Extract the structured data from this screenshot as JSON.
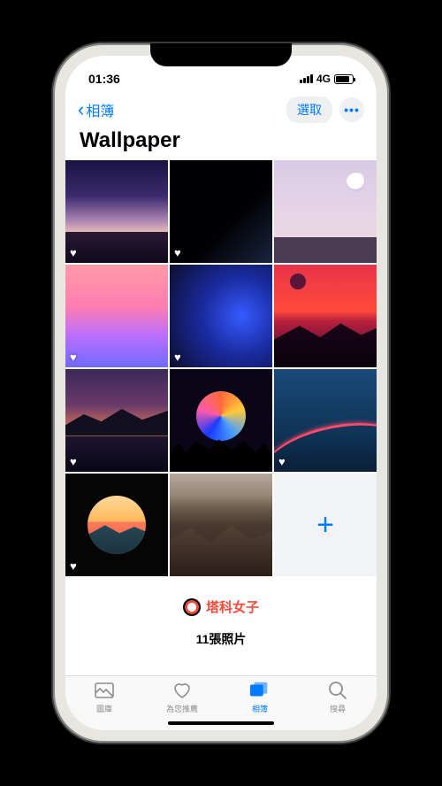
{
  "status": {
    "time": "01:36",
    "network": "4G"
  },
  "nav": {
    "back_label": "相簿",
    "select_label": "選取",
    "more_label": "•••"
  },
  "album": {
    "title": "Wallpaper",
    "count_label": "11張照片",
    "add_label": "+"
  },
  "watermark": {
    "text": "塔科女子"
  },
  "tabs": {
    "library": "圖庫",
    "for_you": "為您推薦",
    "albums": "相簿",
    "search": "搜尋"
  },
  "thumbnails": [
    {
      "id": "thumb-1",
      "favorited": true
    },
    {
      "id": "thumb-2",
      "favorited": true
    },
    {
      "id": "thumb-3",
      "favorited": true
    },
    {
      "id": "thumb-4",
      "favorited": true
    },
    {
      "id": "thumb-5",
      "favorited": true
    },
    {
      "id": "thumb-6",
      "favorited": true
    },
    {
      "id": "thumb-7",
      "favorited": true
    },
    {
      "id": "thumb-8",
      "favorited": true
    },
    {
      "id": "thumb-9",
      "favorited": true
    },
    {
      "id": "thumb-10",
      "favorited": true
    },
    {
      "id": "thumb-11",
      "favorited": true
    }
  ]
}
